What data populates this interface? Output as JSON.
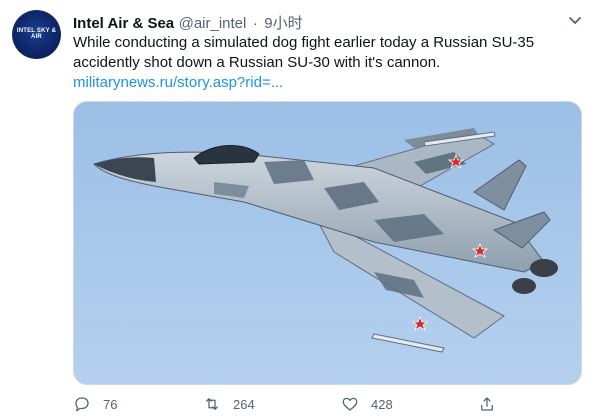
{
  "user": {
    "name": "Intel Air & Sea",
    "handle": "@air_intel",
    "separator": "·",
    "time": "9小时",
    "avatar_text": "INTEL SKY & AIR"
  },
  "tweet": {
    "text": "While conducting a simulated dog fight earlier today a Russian SU-35 accidently shot down a Russian SU-30 with it's cannon.",
    "link": "militarynews.ru/story.asp?rid=..."
  },
  "actions": {
    "reply": "76",
    "retweet": "264",
    "like": "428"
  },
  "icons": [
    "chevron-down-icon",
    "reply-icon",
    "retweet-icon",
    "like-icon",
    "share-icon"
  ],
  "colors": {
    "link": "#1b95e0",
    "secondary_text": "#536471",
    "sky": "#a7c7ea",
    "roundel_red": "#d32f2f"
  }
}
